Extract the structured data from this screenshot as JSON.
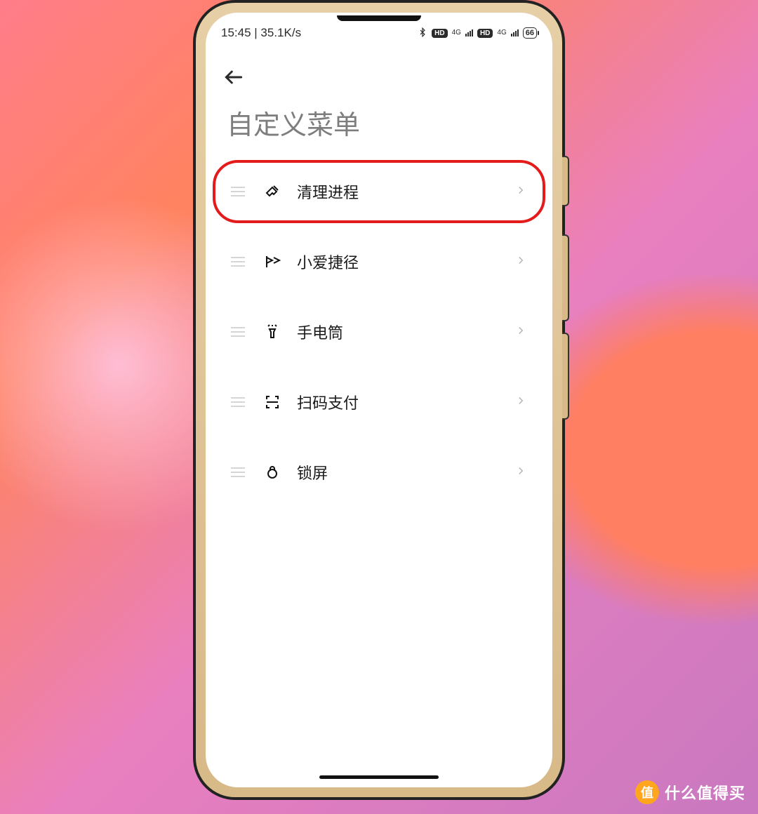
{
  "statusbar": {
    "time": "15:45",
    "speed": "35.1K/s",
    "hd": "HD",
    "net": "4G",
    "battery": "66"
  },
  "page": {
    "title": "自定义菜单"
  },
  "menu": [
    {
      "label": "清理进程",
      "highlight": true,
      "icon": "broom"
    },
    {
      "label": "小爱捷径",
      "highlight": false,
      "icon": "flag"
    },
    {
      "label": "手电筒",
      "highlight": false,
      "icon": "flashlight"
    },
    {
      "label": "扫码支付",
      "highlight": false,
      "icon": "scan"
    },
    {
      "label": "锁屏",
      "highlight": false,
      "icon": "lock"
    }
  ],
  "watermark": {
    "badge": "值",
    "text": "什么值得买"
  }
}
